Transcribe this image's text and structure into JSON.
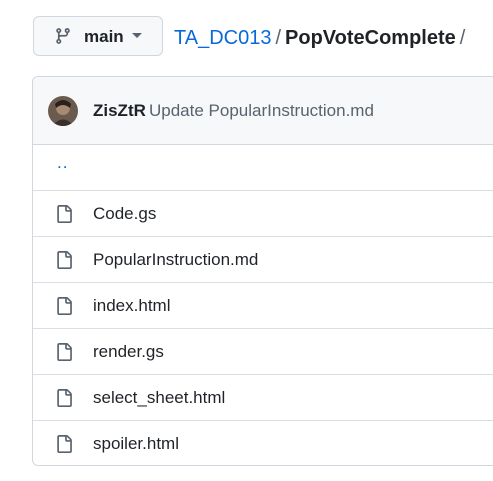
{
  "branch": {
    "name": "main"
  },
  "breadcrumb": {
    "repo": "TA_DC013",
    "separator": "/",
    "current": "PopVoteComplete",
    "trailing": "/"
  },
  "commit": {
    "author": "ZisZtR",
    "message": "Update PopularInstruction.md"
  },
  "parent_dir": "..",
  "files": [
    {
      "name": "Code.gs",
      "icon": "file-icon"
    },
    {
      "name": "PopularInstruction.md",
      "icon": "file-icon"
    },
    {
      "name": "index.html",
      "icon": "file-icon"
    },
    {
      "name": "render.gs",
      "icon": "file-icon"
    },
    {
      "name": "select_sheet.html",
      "icon": "file-icon"
    },
    {
      "name": "spoiler.html",
      "icon": "file-icon"
    }
  ],
  "colors": {
    "link": "#0969da",
    "text": "#1f2328",
    "muted": "#59636e",
    "border": "#d0d7de",
    "header_bg": "#f6f8fa"
  }
}
